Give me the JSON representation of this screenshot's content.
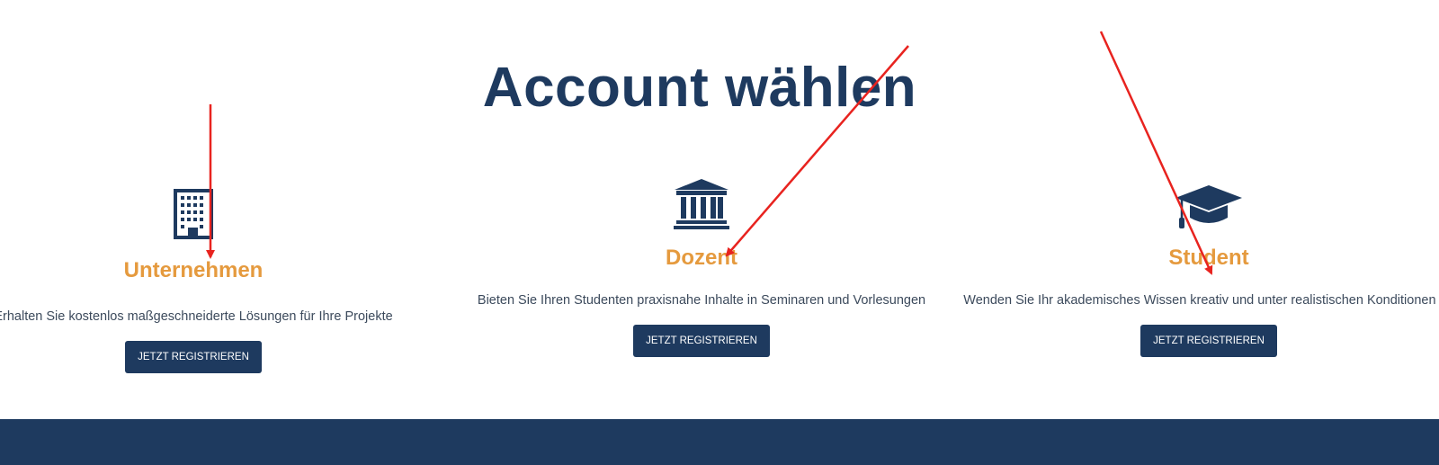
{
  "page": {
    "title": "Account wählen"
  },
  "cards": [
    {
      "id": "unternehmen",
      "icon": "building-icon",
      "title": "Unternehmen",
      "description": "Erhalten Sie kostenlos maßgeschneiderte Lösungen für Ihre Projekte",
      "button": "JETZT REGISTRIEREN"
    },
    {
      "id": "dozent",
      "icon": "university-icon",
      "title": "Dozent",
      "description": "Bieten Sie Ihren Studenten praxisnahe Inhalte in Seminaren und Vorlesungen",
      "button": "JETZT REGISTRIEREN"
    },
    {
      "id": "student",
      "icon": "graduation-cap-icon",
      "title": "Student",
      "description": "Wenden Sie Ihr akademisches Wissen kreativ und unter realistischen Konditionen an",
      "button": "JETZT REGISTRIEREN"
    }
  ],
  "colors": {
    "primary": "#1e3a5f",
    "accent": "#e59a3e",
    "annotation": "#e8231f"
  }
}
